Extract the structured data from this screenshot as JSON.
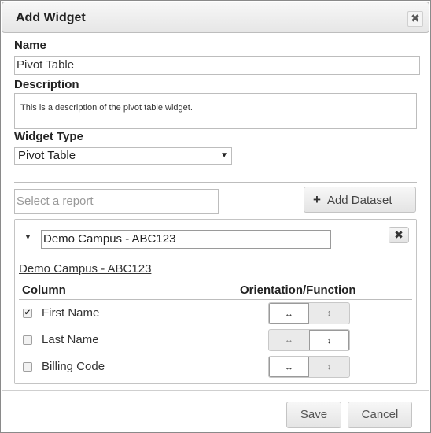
{
  "dialog": {
    "title": "Add Widget",
    "close_glyph": "✖"
  },
  "name": {
    "label": "Name",
    "value": "Pivot Table"
  },
  "description": {
    "label": "Description",
    "value": "This is a description of the pivot table widget."
  },
  "widget_type": {
    "label": "Widget Type",
    "selected": "Pivot Table"
  },
  "report": {
    "placeholder": "Select a report"
  },
  "add_dataset": {
    "icon": "plus-icon",
    "label": "Add Dataset"
  },
  "dataset": {
    "toggle_icon": "caret-down-icon",
    "name_value": "Demo Campus - ABC123",
    "remove_glyph": "✖",
    "link_text": "Demo Campus - ABC123",
    "headers": {
      "column": "Column",
      "orientation": "Orientation/Function"
    },
    "rows": [
      {
        "label": "First Name",
        "checked": true,
        "orientation": "horizontal"
      },
      {
        "label": "Last Name",
        "checked": false,
        "orientation": "vertical"
      },
      {
        "label": "Billing Code",
        "checked": false,
        "orientation": "horizontal"
      }
    ],
    "orientation_icons": {
      "horizontal": "↔",
      "vertical": "↕"
    }
  },
  "footer": {
    "save": "Save",
    "cancel": "Cancel"
  }
}
